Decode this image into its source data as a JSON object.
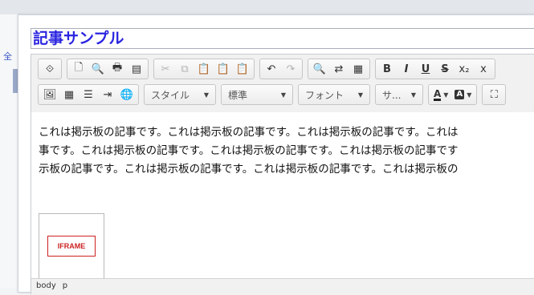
{
  "background": {
    "link_glyph": "全"
  },
  "title_field": {
    "value": "記事サンプル"
  },
  "toolbar": {
    "row1": [
      [
        {
          "name": "source",
          "glyph": "⟐",
          "enabled": true
        }
      ],
      [
        {
          "name": "new-page",
          "glyph": "🗋",
          "enabled": true
        },
        {
          "name": "preview",
          "glyph": "🔍",
          "enabled": true
        },
        {
          "name": "print",
          "glyph": "🖶",
          "enabled": true
        },
        {
          "name": "templates",
          "glyph": "▤",
          "enabled": true
        }
      ],
      [
        {
          "name": "cut",
          "glyph": "✂",
          "enabled": false
        },
        {
          "name": "copy",
          "glyph": "⧉",
          "enabled": false
        },
        {
          "name": "paste",
          "glyph": "📋",
          "enabled": true
        },
        {
          "name": "paste-text",
          "glyph": "📋",
          "enabled": true
        },
        {
          "name": "paste-word",
          "glyph": "📋",
          "enabled": true
        }
      ],
      [
        {
          "name": "undo",
          "glyph": "↶",
          "enabled": true
        },
        {
          "name": "redo",
          "glyph": "↷",
          "enabled": false
        }
      ],
      [
        {
          "name": "find",
          "glyph": "🔍",
          "enabled": true
        },
        {
          "name": "replace",
          "glyph": "⇄",
          "enabled": true
        },
        {
          "name": "select-all",
          "glyph": "▦",
          "enabled": true
        }
      ],
      [
        {
          "name": "bold",
          "glyph": "B",
          "enabled": true
        },
        {
          "name": "italic",
          "glyph": "I",
          "enabled": true
        },
        {
          "name": "underline",
          "glyph": "U",
          "enabled": true
        },
        {
          "name": "strike",
          "glyph": "S",
          "enabled": true
        },
        {
          "name": "subscript",
          "glyph": "x₂",
          "enabled": true
        },
        {
          "name": "superscript",
          "glyph": "x",
          "enabled": true
        }
      ]
    ],
    "row2_buttons": [
      {
        "name": "image",
        "glyph": "🖼"
      },
      {
        "name": "table",
        "glyph": "▦"
      },
      {
        "name": "horizontal-rule",
        "glyph": "☰"
      },
      {
        "name": "indent",
        "glyph": "⇥"
      },
      {
        "name": "link",
        "glyph": "🌐"
      }
    ],
    "style_combo": "スタイル",
    "format_combo": "標準",
    "font_combo": "フォント",
    "size_combo": "サ...",
    "text_color": "A",
    "bg_color": "A",
    "maximize_glyph": "⛶"
  },
  "content": {
    "lines": [
      "これは掲示板の記事です。これは掲示板の記事です。これは掲示板の記事です。これは",
      "事です。これは掲示板の記事です。これは掲示板の記事です。これは掲示板の記事です",
      "示板の記事です。これは掲示板の記事です。これは掲示板の記事です。これは掲示板の"
    ],
    "iframe_label": "IFRAME"
  },
  "statusbar": {
    "path": [
      "body",
      "p"
    ]
  },
  "colors": {
    "title_text": "#2a24e0",
    "iframe_border": "#cc2222"
  }
}
